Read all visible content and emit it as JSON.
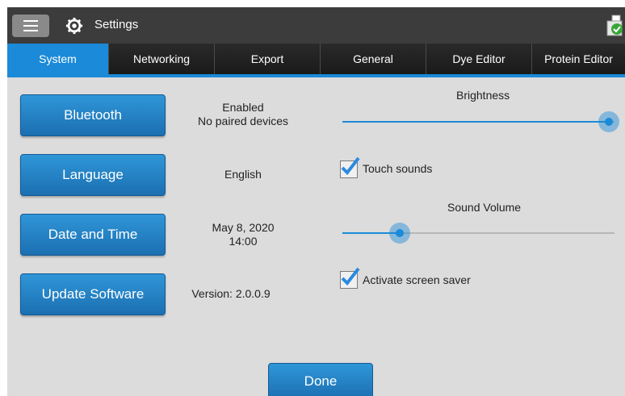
{
  "titlebar": {
    "title": "Settings",
    "menu_icon": "hamburger-menu-icon",
    "settings_icon": "gear-icon",
    "status_icon": "instrument-status-icon"
  },
  "tabs": [
    {
      "label": "System",
      "active": true
    },
    {
      "label": "Networking",
      "active": false
    },
    {
      "label": "Export",
      "active": false
    },
    {
      "label": "General",
      "active": false
    },
    {
      "label": "Dye Editor",
      "active": false
    },
    {
      "label": "Protein Editor",
      "active": false
    }
  ],
  "settings": {
    "bluetooth": {
      "label": "Bluetooth",
      "status_line1": "Enabled",
      "status_line2": "No paired devices"
    },
    "language": {
      "label": "Language",
      "value": "English"
    },
    "datetime": {
      "label": "Date and Time",
      "date": "May 8, 2020",
      "time": "14:00"
    },
    "update": {
      "label": "Update Software",
      "version": "Version: 2.0.0.9"
    }
  },
  "brightness": {
    "label": "Brightness",
    "level": 0.98
  },
  "touch_sounds": {
    "label": "Touch sounds",
    "checked": true
  },
  "sound_volume": {
    "label": "Sound Volume",
    "level": 0.21
  },
  "screen_saver": {
    "label": "Activate screen saver",
    "checked": true
  },
  "done_label": "Done",
  "colors": {
    "accent": "#1b8ad8",
    "titlebar": "#3c3c3c",
    "background": "#dcdcdc"
  }
}
